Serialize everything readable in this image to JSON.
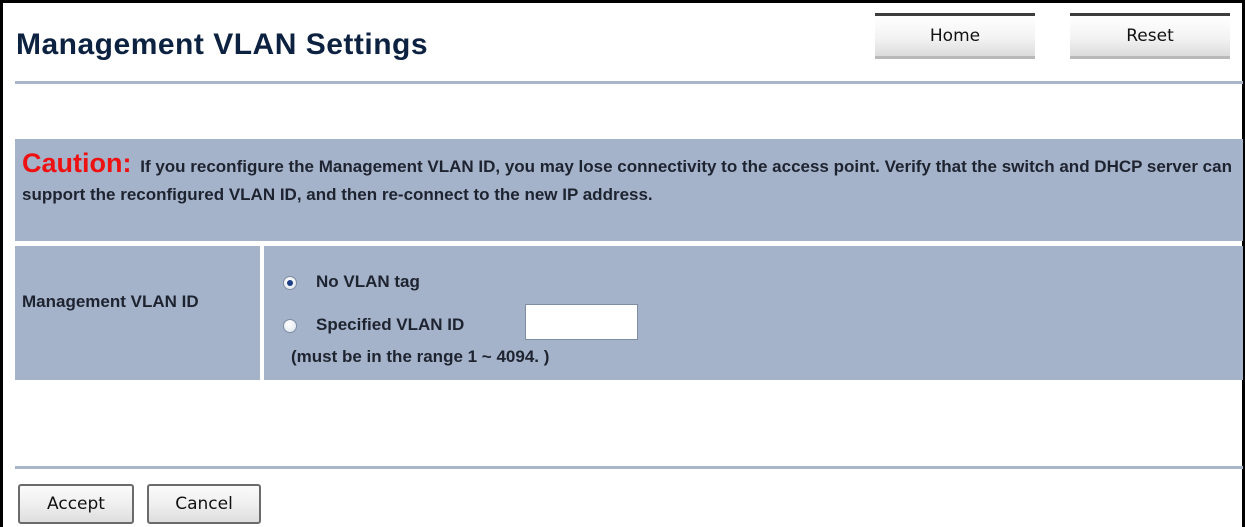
{
  "header": {
    "title": "Management VLAN Settings",
    "home_label": "Home",
    "reset_label": "Reset"
  },
  "caution": {
    "word": "Caution:",
    "text": "If you reconfigure the Management VLAN ID, you may lose connectivity to the access point. Verify that the switch and DHCP server can support the reconfigured VLAN ID, and then re-connect to the new IP address."
  },
  "vlan_setting": {
    "label": "Management VLAN ID",
    "options": [
      {
        "label": "No VLAN tag",
        "checked": true
      },
      {
        "label": "Specified VLAN ID",
        "checked": false
      }
    ],
    "vlan_id_value": "",
    "range_note": "(must be in the range 1 ~ 4094. )"
  },
  "actions": {
    "accept_label": "Accept",
    "cancel_label": "Cancel"
  },
  "colors": {
    "title": "#0d2240",
    "panel_bg": "#a4b3ca",
    "caution_red": "#ee1111",
    "divider": "#a9b5c9"
  }
}
